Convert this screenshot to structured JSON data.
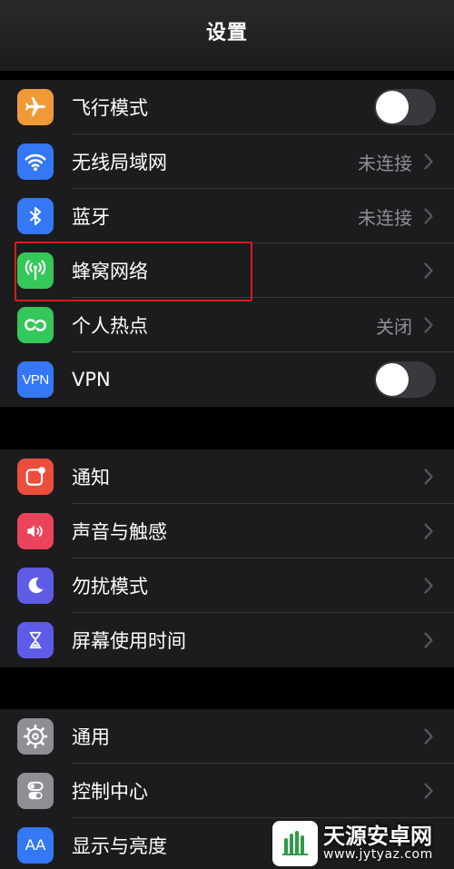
{
  "header": {
    "title": "设置"
  },
  "colors": {
    "orange": "#f09a37",
    "blue": "#3478f6",
    "green": "#34c759",
    "red": "#eb4e3d",
    "pink": "#eb445a",
    "indigo": "#5e5ce6",
    "gray": "#8e8e93",
    "highlight": "#d71920"
  },
  "groups": [
    {
      "items": [
        {
          "label": "飞行模式",
          "icon": "airplane-icon",
          "accessory": "toggle",
          "toggle_on": false
        },
        {
          "label": "无线局域网",
          "icon": "wifi-icon",
          "value": "未连接"
        },
        {
          "label": "蓝牙",
          "icon": "bluetooth-icon",
          "value": "未连接"
        },
        {
          "label": "蜂窝网络",
          "icon": "antenna-icon",
          "highlighted": true
        },
        {
          "label": "个人热点",
          "icon": "hotspot-link-icon",
          "value": "关闭"
        },
        {
          "label": "VPN",
          "icon": "vpn-icon",
          "icon_text": "VPN",
          "accessory": "toggle",
          "toggle_on": false
        }
      ]
    },
    {
      "items": [
        {
          "label": "通知",
          "icon": "notification-icon"
        },
        {
          "label": "声音与触感",
          "icon": "speaker-icon"
        },
        {
          "label": "勿扰模式",
          "icon": "moon-icon"
        },
        {
          "label": "屏幕使用时间",
          "icon": "hourglass-icon"
        }
      ]
    },
    {
      "items": [
        {
          "label": "通用",
          "icon": "gear-icon"
        },
        {
          "label": "控制中心",
          "icon": "switches-icon"
        },
        {
          "label": "显示与亮度",
          "icon": "text-size-icon",
          "icon_text": "AA"
        }
      ]
    }
  ],
  "watermark": {
    "title": "天源安卓网",
    "url": "www.jytyaz.com"
  }
}
